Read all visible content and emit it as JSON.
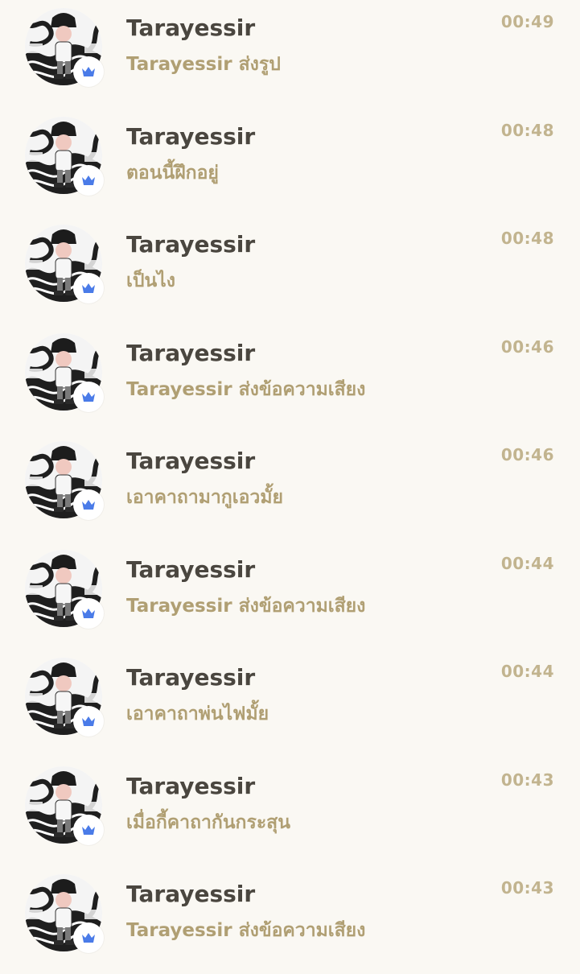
{
  "colors": {
    "background": "#faf8f3",
    "name_text": "#4a463f",
    "preview_text": "#b09f73",
    "time_text": "#c2b48f",
    "badge_icon": "#4a7be8"
  },
  "icons": {
    "avatar": "avatar-icon",
    "badge": "crown-badge-icon"
  },
  "chats": [
    {
      "name": "Tarayessir",
      "preview": "Tarayessir ส่งรูป",
      "time": "00:49"
    },
    {
      "name": "Tarayessir",
      "preview": "ตอนนี้ฝึกอยู่",
      "time": "00:48"
    },
    {
      "name": "Tarayessir",
      "preview": "เป็นไง",
      "time": "00:48"
    },
    {
      "name": "Tarayessir",
      "preview": "Tarayessir ส่งข้อความเสียง",
      "time": "00:46"
    },
    {
      "name": "Tarayessir",
      "preview": "เอาคาถามากูเอวมั้ย",
      "time": "00:46"
    },
    {
      "name": "Tarayessir",
      "preview": "Tarayessir ส่งข้อความเสียง",
      "time": "00:44"
    },
    {
      "name": "Tarayessir",
      "preview": "เอาคาถาพ่นไฟมั้ย",
      "time": "00:44"
    },
    {
      "name": "Tarayessir",
      "preview": "เมื่อกี้คาถากันกระสุน",
      "time": "00:43"
    },
    {
      "name": "Tarayessir",
      "preview": "Tarayessir ส่งข้อความเสียง",
      "time": "00:43"
    }
  ]
}
